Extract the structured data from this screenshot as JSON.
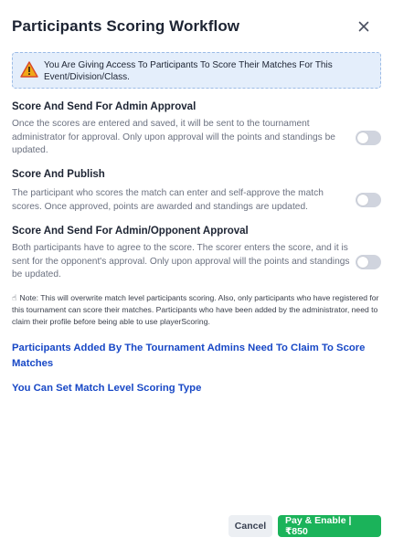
{
  "modal": {
    "title": "Participants Scoring Workflow",
    "close_icon": "close-icon"
  },
  "notice": {
    "icon": "warning-icon",
    "text": "You Are Giving Access To Participants To Score Their Matches For This Event/Division/Class."
  },
  "options": [
    {
      "heading": "Score And Send For Admin Approval",
      "description": "Once the scores are entered and saved, it will be sent to the tournament administrator for approval. Only upon approval will the points and standings be updated.",
      "enabled": false
    },
    {
      "heading": "Score And Publish",
      "description": "The participant who scores the match can enter and self-approve the match scores. Once approved, points are awarded and standings are updated.",
      "enabled": false
    },
    {
      "heading": "Score And Send For Admin/Opponent Approval",
      "description": "Both participants have to agree to the score. The scorer enters the score, and it is sent for the opponent's approval. Only upon approval will the points and standings be updated.",
      "enabled": false
    }
  ],
  "note": {
    "icon": "hand-pointer-icon",
    "text": "Note: This will overwrite match level participants scoring. Also, only participants who have registered for this tournament can score their matches. Participants who have been added by the administrator, need to claim their profile before being able to use playerScoring."
  },
  "links": {
    "claim": "Participants Added By The Tournament Admins Need To Claim To Score Matches",
    "match_level": "You Can Set Match Level Scoring Type"
  },
  "footer": {
    "cancel_label": "Cancel",
    "pay_label": "Pay & Enable | ₹850"
  },
  "colors": {
    "primary_link": "#1848c6",
    "pay_button": "#1bb35a",
    "notice_bg": "#e4eefb",
    "toggle_off": "#d0d4de"
  }
}
